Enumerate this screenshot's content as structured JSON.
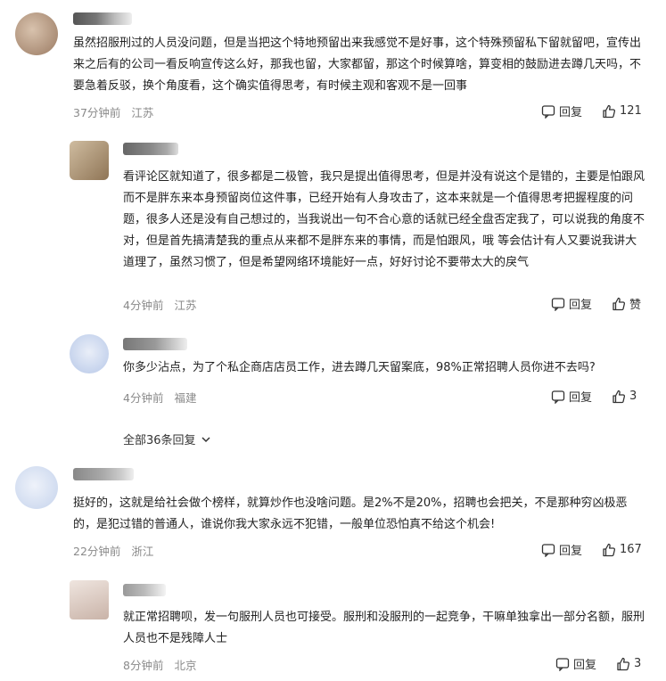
{
  "comments": [
    {
      "text": "虽然招服刑过的人员没问题，但是当把这个特地预留出来我感觉不是好事，这个特殊预留私下留就留吧，宣传出来之后有的公司一看反响宣传这么好，那我也留，大家都留，那这个时候算啥，算变相的鼓励进去蹲几天吗，不要急着反驳，换个角度看，这个确实值得思考，有时候主观和客观不是一回事",
      "time": "37分钟前",
      "location": "江苏",
      "reply_label": "回复",
      "like_label": "121",
      "avatar_color": "#b89a82"
    },
    {
      "text": "看评论区就知道了，很多都是二极管，我只是提出值得思考，但是并没有说这个是错的，主要是怕跟风而不是胖东来本身预留岗位这件事，已经开始有人身攻击了，这本来就是一个值得思考把握程度的问题，很多人还是没有自己想过的，当我说出一句不合心意的话就已经全盘否定我了，可以说我的角度不对，但是首先搞清楚我的重点从来都不是胖东来的事情，而是怕跟风，哦 等会估计有人又要说我讲大道理了，虽然习惯了，但是希望网络环境能好一点，好好讨论不要带太大的戾气",
      "time": "4分钟前",
      "location": "江苏",
      "reply_label": "回复",
      "like_label": "赞",
      "avatar_color": "#a08866"
    },
    {
      "text": "你多少沾点，为了个私企商店店员工作，进去蹲几天留案底，98%正常招聘人员你进不去吗?",
      "time": "4分钟前",
      "location": "福建",
      "reply_label": "回复",
      "like_label": "3",
      "avatar_color": "#c9d6ee"
    },
    {
      "text": "挺好的，这就是给社会做个榜样，就算炒作也没啥问题。是2%不是20%，招聘也会把关，不是那种穷凶极恶的，是犯过错的普通人，谁说你我大家永远不犯错，一般单位恐怕真不给这个机会!",
      "time": "22分钟前",
      "location": "浙江",
      "reply_label": "回复",
      "like_label": "167",
      "avatar_color": "#d5dff0"
    },
    {
      "text": "就正常招聘呗，发一句服刑人员也可接受。服刑和没服刑的一起竞争，干嘛单独拿出一部分名额，服刑人员也不是残障人士",
      "time": "8分钟前",
      "location": "北京",
      "reply_label": "回复",
      "like_label": "3",
      "avatar_color": "#dccfc8"
    }
  ],
  "more_replies_label": "全部36条回复",
  "colors": {
    "meta": "#8a8a8a",
    "text": "#222222"
  }
}
